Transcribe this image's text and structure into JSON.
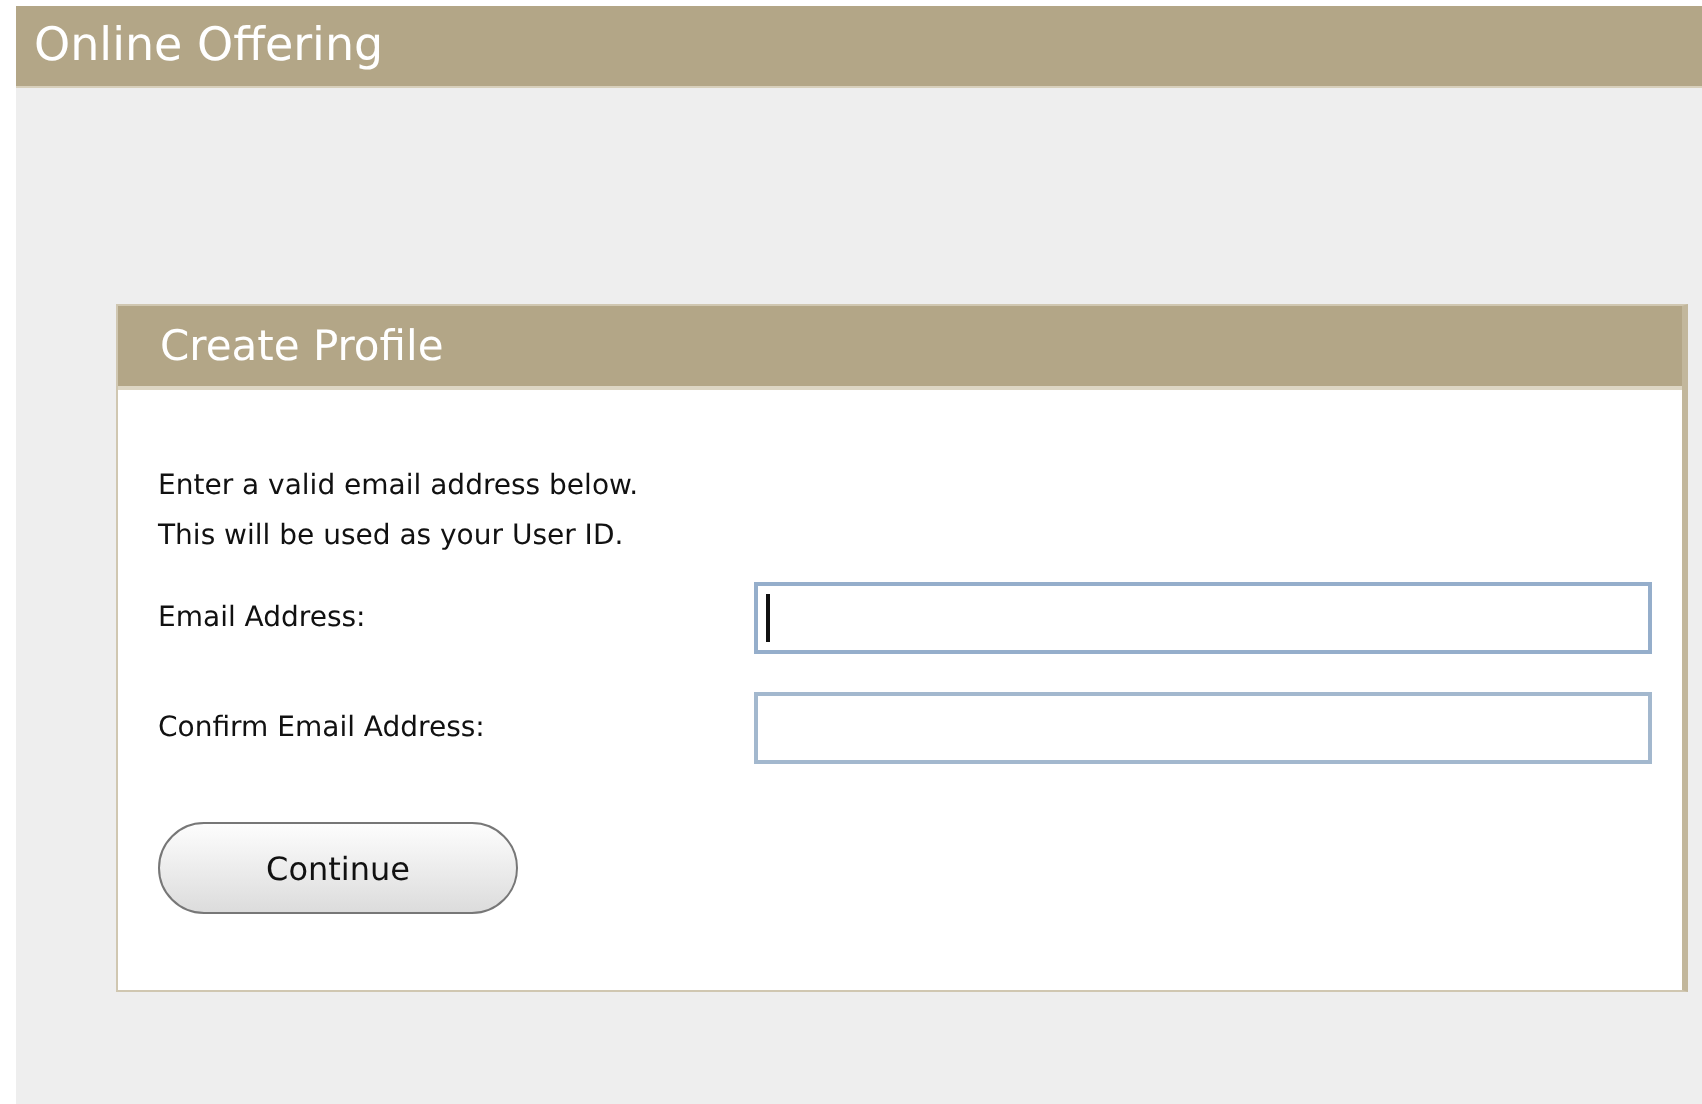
{
  "header": {
    "title": "Online Offering"
  },
  "panel": {
    "title": "Create Profile",
    "intro": [
      "Enter a valid email address below.",
      "This will be used as your User ID."
    ],
    "fields": [
      {
        "label": "Email Address:",
        "focused": true
      },
      {
        "label": "Confirm Email Address:",
        "focused": false
      }
    ],
    "button": "Continue"
  }
}
